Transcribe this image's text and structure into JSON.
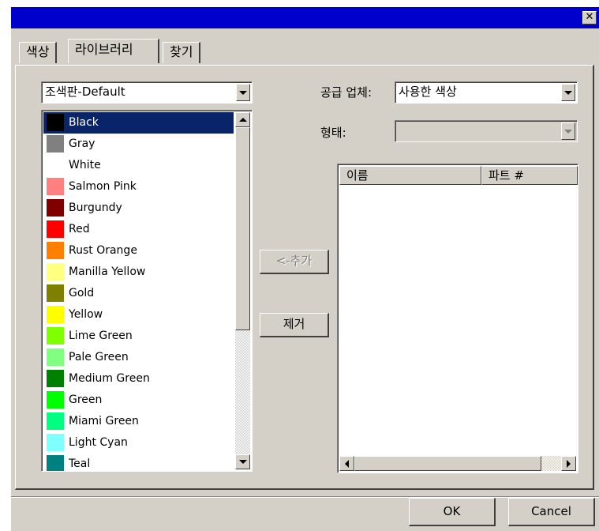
{
  "window": {
    "close_label": "✕"
  },
  "tabs": [
    {
      "label": "색상"
    },
    {
      "label": "라이브러리"
    },
    {
      "label": "찾기"
    }
  ],
  "library": {
    "value": "조색판-Default"
  },
  "colors": [
    {
      "name": "Black",
      "hex": "#000000"
    },
    {
      "name": "Gray",
      "hex": "#808080"
    },
    {
      "name": "White",
      "hex": "#ffffff"
    },
    {
      "name": "Salmon Pink",
      "hex": "#ff8080"
    },
    {
      "name": "Burgundy",
      "hex": "#800000"
    },
    {
      "name": "Red",
      "hex": "#ff0000"
    },
    {
      "name": "Rust Orange",
      "hex": "#ff8000"
    },
    {
      "name": "Manilla Yellow",
      "hex": "#ffff80"
    },
    {
      "name": "Gold",
      "hex": "#808000"
    },
    {
      "name": "Yellow",
      "hex": "#ffff00"
    },
    {
      "name": "Lime Green",
      "hex": "#80ff00"
    },
    {
      "name": "Pale Green",
      "hex": "#80ff80"
    },
    {
      "name": "Medium Green",
      "hex": "#008000"
    },
    {
      "name": "Green",
      "hex": "#00ff00"
    },
    {
      "name": "Miami Green",
      "hex": "#00ff80"
    },
    {
      "name": "Light Cyan",
      "hex": "#80ffff"
    },
    {
      "name": "Teal",
      "hex": "#008080"
    }
  ],
  "supplier": {
    "label": "공급 업체:",
    "value": "사용한 색상"
  },
  "form": {
    "label": "형태:",
    "value": ""
  },
  "buttons": {
    "add": "<-추가",
    "remove": "제거",
    "ok": "OK",
    "cancel": "Cancel"
  },
  "parts_table": {
    "columns": [
      "이름",
      "파트 #"
    ],
    "rows": []
  },
  "accent": {
    "titlebar": "#0000cc",
    "selection": "#0a246a"
  }
}
